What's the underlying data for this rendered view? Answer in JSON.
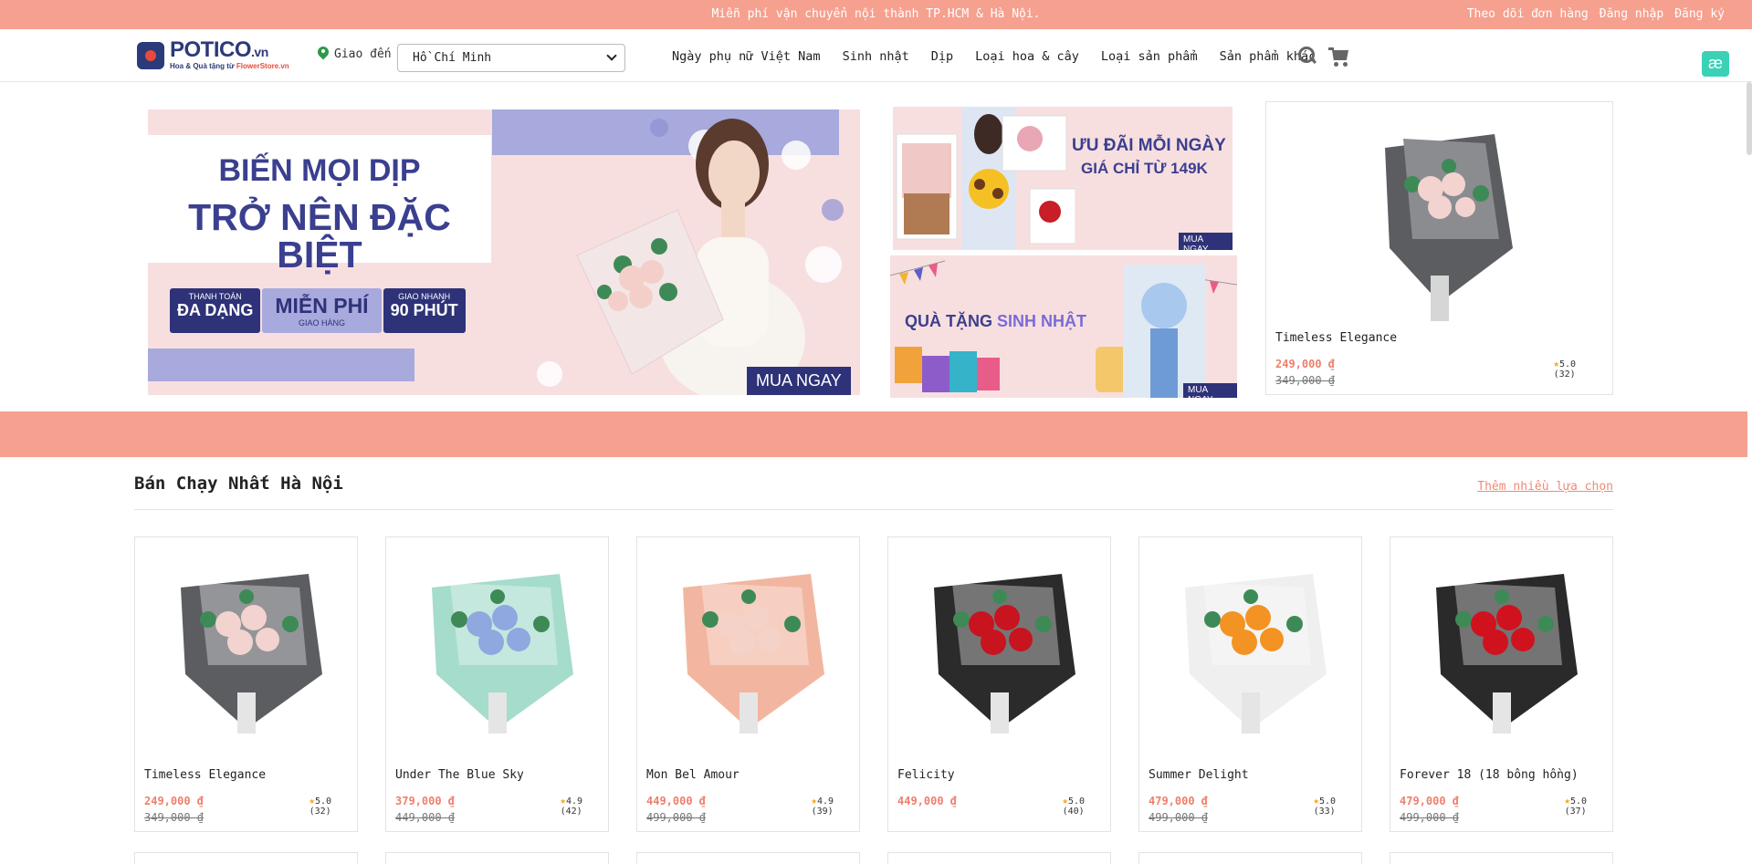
{
  "topbar": {
    "promo": "Miễn phí vận chuyển nội thành TP.HCM & Hà Nội.",
    "links": [
      "Theo dõi đơn hàng",
      "Đăng nhập",
      "Đăng ký"
    ]
  },
  "header": {
    "logo": {
      "name": "POTICO",
      "tld": ".vn",
      "tagline": "Hoa & Quà tặng từ ",
      "tagline_brand": "FlowerStore.vn"
    },
    "deliver_label": "Giao đến",
    "city": "Hồ Chí Minh",
    "nav": [
      "Ngày phụ nữ Việt Nam",
      "Sinh nhật",
      "Dịp",
      "Loại hoa & cây",
      "Loại sản phẩm",
      "Sản phẩm khác"
    ],
    "badge": "æ"
  },
  "hero": {
    "line1": "BIẾN MỌI DỊP",
    "line2": "TRỞ NÊN ĐẶC BIỆT",
    "badges": [
      {
        "small": "THANH TOÁN",
        "big": "ĐA DẠNG"
      },
      {
        "small": "GIAO HÀNG",
        "big": "MIỄN PHÍ"
      },
      {
        "small": "GIAO NHANH",
        "big": "90 PHÚT"
      }
    ],
    "cta": "MUA NGAY"
  },
  "promo1": {
    "line1": "ƯU ĐÃI MỖI NGÀY",
    "line2": "GIÁ CHỈ TỪ 149K",
    "cta": "MUA NGAY"
  },
  "promo2": {
    "line1_a": "QUÀ TẶNG ",
    "line1_b": "SINH NHẬT",
    "cta": "MUA NGAY"
  },
  "feature": {
    "name": "Timeless Elegance",
    "price": "249,000 ₫",
    "old": "349,000 ₫",
    "rating": "5.0",
    "count": "(32)"
  },
  "section": {
    "title": "Bán Chạy Nhất Hà Nội",
    "more": "Thêm nhiều lựa chọn"
  },
  "products": [
    {
      "name": "Timeless Elegance",
      "price": "249,000 ₫",
      "old": "349,000 ₫",
      "rating": "5.0",
      "count": "(32)",
      "wrap": "#5b5d61",
      "flower": "#f3d3cf"
    },
    {
      "name": "Under The Blue Sky",
      "price": "379,000 ₫",
      "old": "449,000 ₫",
      "rating": "4.9",
      "count": "(42)",
      "wrap": "#a5dccb",
      "flower": "#8fa8e0"
    },
    {
      "name": "Mon Bel Amour",
      "price": "449,000 ₫",
      "old": "499,000 ₫",
      "rating": "4.9",
      "count": "(39)",
      "wrap": "#f2b6a0",
      "flower": "#f4d2c8"
    },
    {
      "name": "Felicity",
      "price": "449,000 ₫",
      "old": "",
      "rating": "5.0",
      "count": "(40)",
      "wrap": "#2b2b2b",
      "flower": "#c7141f"
    },
    {
      "name": "Summer Delight",
      "price": "479,000 ₫",
      "old": "499,000 ₫",
      "rating": "5.0",
      "count": "(33)",
      "wrap": "#efefef",
      "flower": "#f39324"
    },
    {
      "name": "Forever 18 (18 bông hồng)",
      "price": "479,000 ₫",
      "old": "499,000 ₫",
      "rating": "5.0",
      "count": "(37)",
      "wrap": "#2a2a2a",
      "flower": "#d0121e"
    }
  ],
  "colors": {
    "salmon": "#f6a08f",
    "navy": "#2e3278",
    "lavender": "#a8a9dc",
    "pink_bg": "#f7dfe0",
    "price": "#ee7f6b"
  }
}
